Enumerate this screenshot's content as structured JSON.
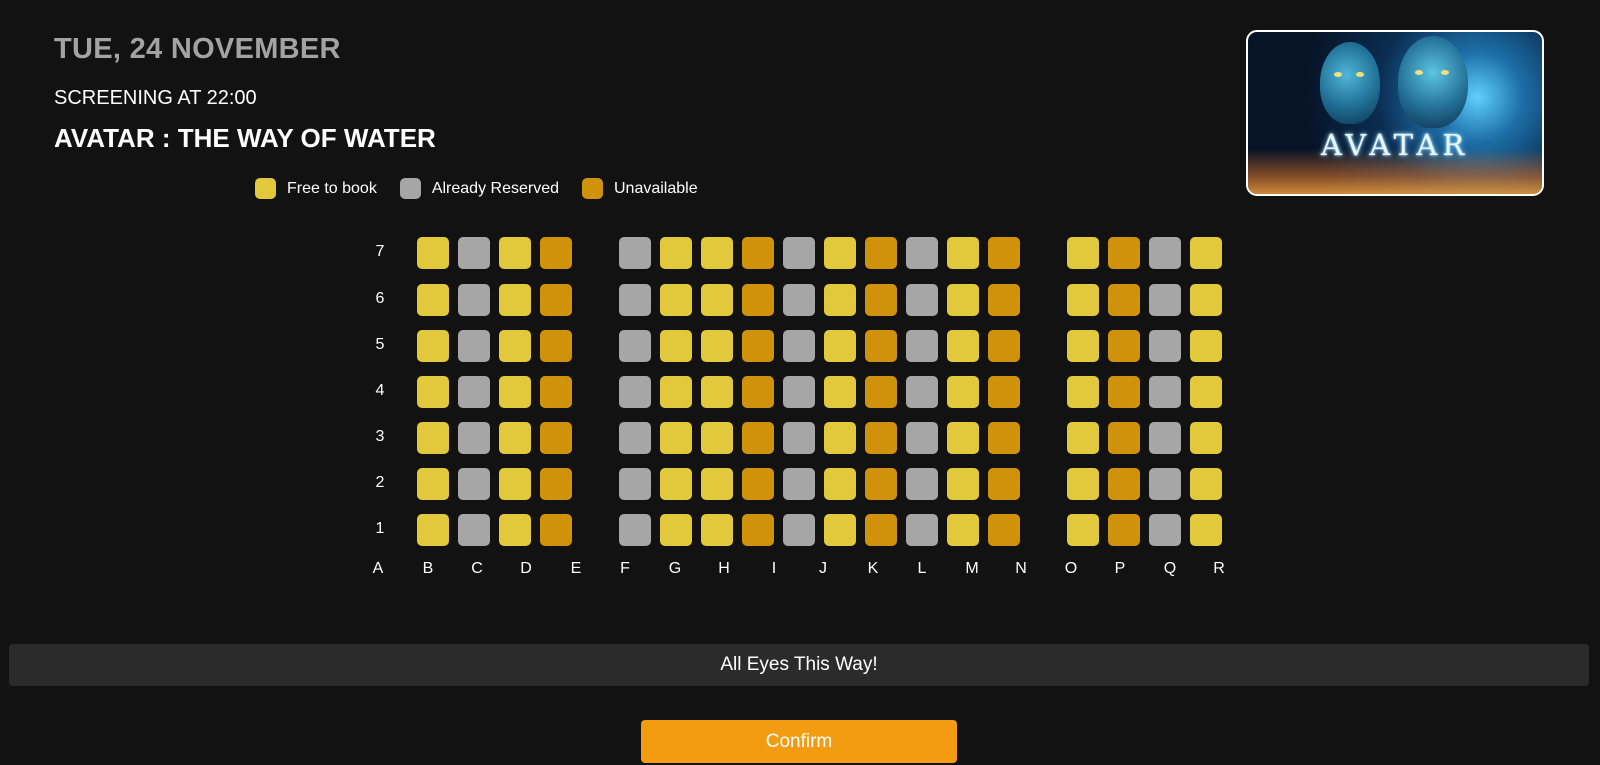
{
  "header": {
    "date": "TUE, 24 NOVEMBER",
    "screening": "SCREENING AT 22:00",
    "movie_title": "AVATAR : THE WAY OF WATER"
  },
  "poster": {
    "logo_text": "AVATAR"
  },
  "legend": [
    {
      "label": "Free to book",
      "status": "free"
    },
    {
      "label": "Already Reserved",
      "status": "reserved"
    },
    {
      "label": "Unavailable",
      "status": "unavailable"
    }
  ],
  "colors": {
    "background": "#121212",
    "free": "#e2c93b",
    "reserved": "#a6a6a6",
    "unavailable": "#d0920a",
    "confirm": "#f39c12",
    "screen_bar": "#2b2b2b"
  },
  "seat_map": {
    "rows": [
      "7",
      "6",
      "5",
      "4",
      "3",
      "2",
      "1"
    ],
    "columns": [
      "A",
      "B",
      "C",
      "D",
      "E",
      "F",
      "G",
      "H",
      "I",
      "J",
      "K",
      "L",
      "M",
      "N",
      "O",
      "P",
      "Q",
      "R"
    ],
    "seat_columns": [
      "B",
      "C",
      "D",
      "E",
      "F",
      "G",
      "H",
      "I",
      "J",
      "K",
      "L",
      "M",
      "N",
      "O",
      "P",
      "Q",
      "R"
    ],
    "column_status": {
      "B": "free",
      "C": "reserved",
      "D": "free",
      "E": "unavailable",
      "F": "reserved",
      "G": "free",
      "H": "free",
      "I": "unavailable",
      "J": "reserved",
      "K": "free",
      "L": "unavailable",
      "M": "reserved",
      "N": "free",
      "O": "unavailable",
      "P": "free",
      "Q": "unavailable",
      "R": "reserved"
    },
    "extra_column_status": {
      "S": "free"
    }
  },
  "screen": {
    "label": "All Eyes This Way!"
  },
  "actions": {
    "confirm_label": "Confirm"
  }
}
